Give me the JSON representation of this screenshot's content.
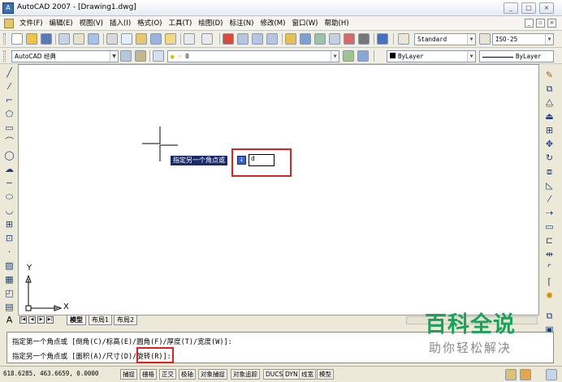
{
  "window": {
    "title": "AutoCAD 2007 - [Drawing1.dwg]",
    "app_icon_label": "A",
    "minimize_label": "_",
    "maximize_label": "□",
    "close_label": "×"
  },
  "menubar": {
    "items": [
      "文件(F)",
      "编辑(E)",
      "视图(V)",
      "插入(I)",
      "格式(O)",
      "工具(T)",
      "绘图(D)",
      "标注(N)",
      "修改(M)",
      "窗口(W)",
      "帮助(H)"
    ],
    "doc_minimize_label": "_",
    "doc_restore_label": "▫",
    "doc_close_label": "×"
  },
  "toolbar1": {
    "text_style": "Standard",
    "dim_style": "ISO-25"
  },
  "toolbar2": {
    "workspace": "AutoCAD 经典",
    "layer": "0",
    "color": "ByLayer",
    "linetype": "ByLayer",
    "lineweight": "ByLayer"
  },
  "drawing": {
    "ucs_y_label": "Y",
    "ucs_x_label": "X"
  },
  "dynamic_input": {
    "prompt": "指定另一个角点或",
    "arrow_icon": "↓",
    "value": "d"
  },
  "layout_tabs": {
    "nav": [
      "|◀",
      "◀",
      "▶",
      "▶|"
    ],
    "tabs": [
      "模型",
      "布局1",
      "布局2"
    ]
  },
  "command": {
    "line1": "指定第一个角点或 [倒角(C)/标高(E)/圆角(F)/厚度(T)/宽度(W)]:",
    "line2_prefix": "指定另一个角点或 [面积(A)/",
    "line2_highlight": "尺寸(D)",
    "line2_suffix": "/旋转(R)]:"
  },
  "statusbar": {
    "coords": "618.6285,  463.6659, 0.0000",
    "buttons": [
      "捕捉",
      "栅格",
      "正交",
      "极轴",
      "对象捕捉",
      "对象追踪",
      "DUCS",
      "DYN",
      "线宽",
      "模型"
    ]
  },
  "watermark": {
    "title": "百科全说",
    "subtitle": "助你轻松解决"
  },
  "colors": {
    "highlight_red": "#e02020",
    "watermark_green": "#19a35a",
    "tooltip_navy": "#1b2a6b"
  }
}
